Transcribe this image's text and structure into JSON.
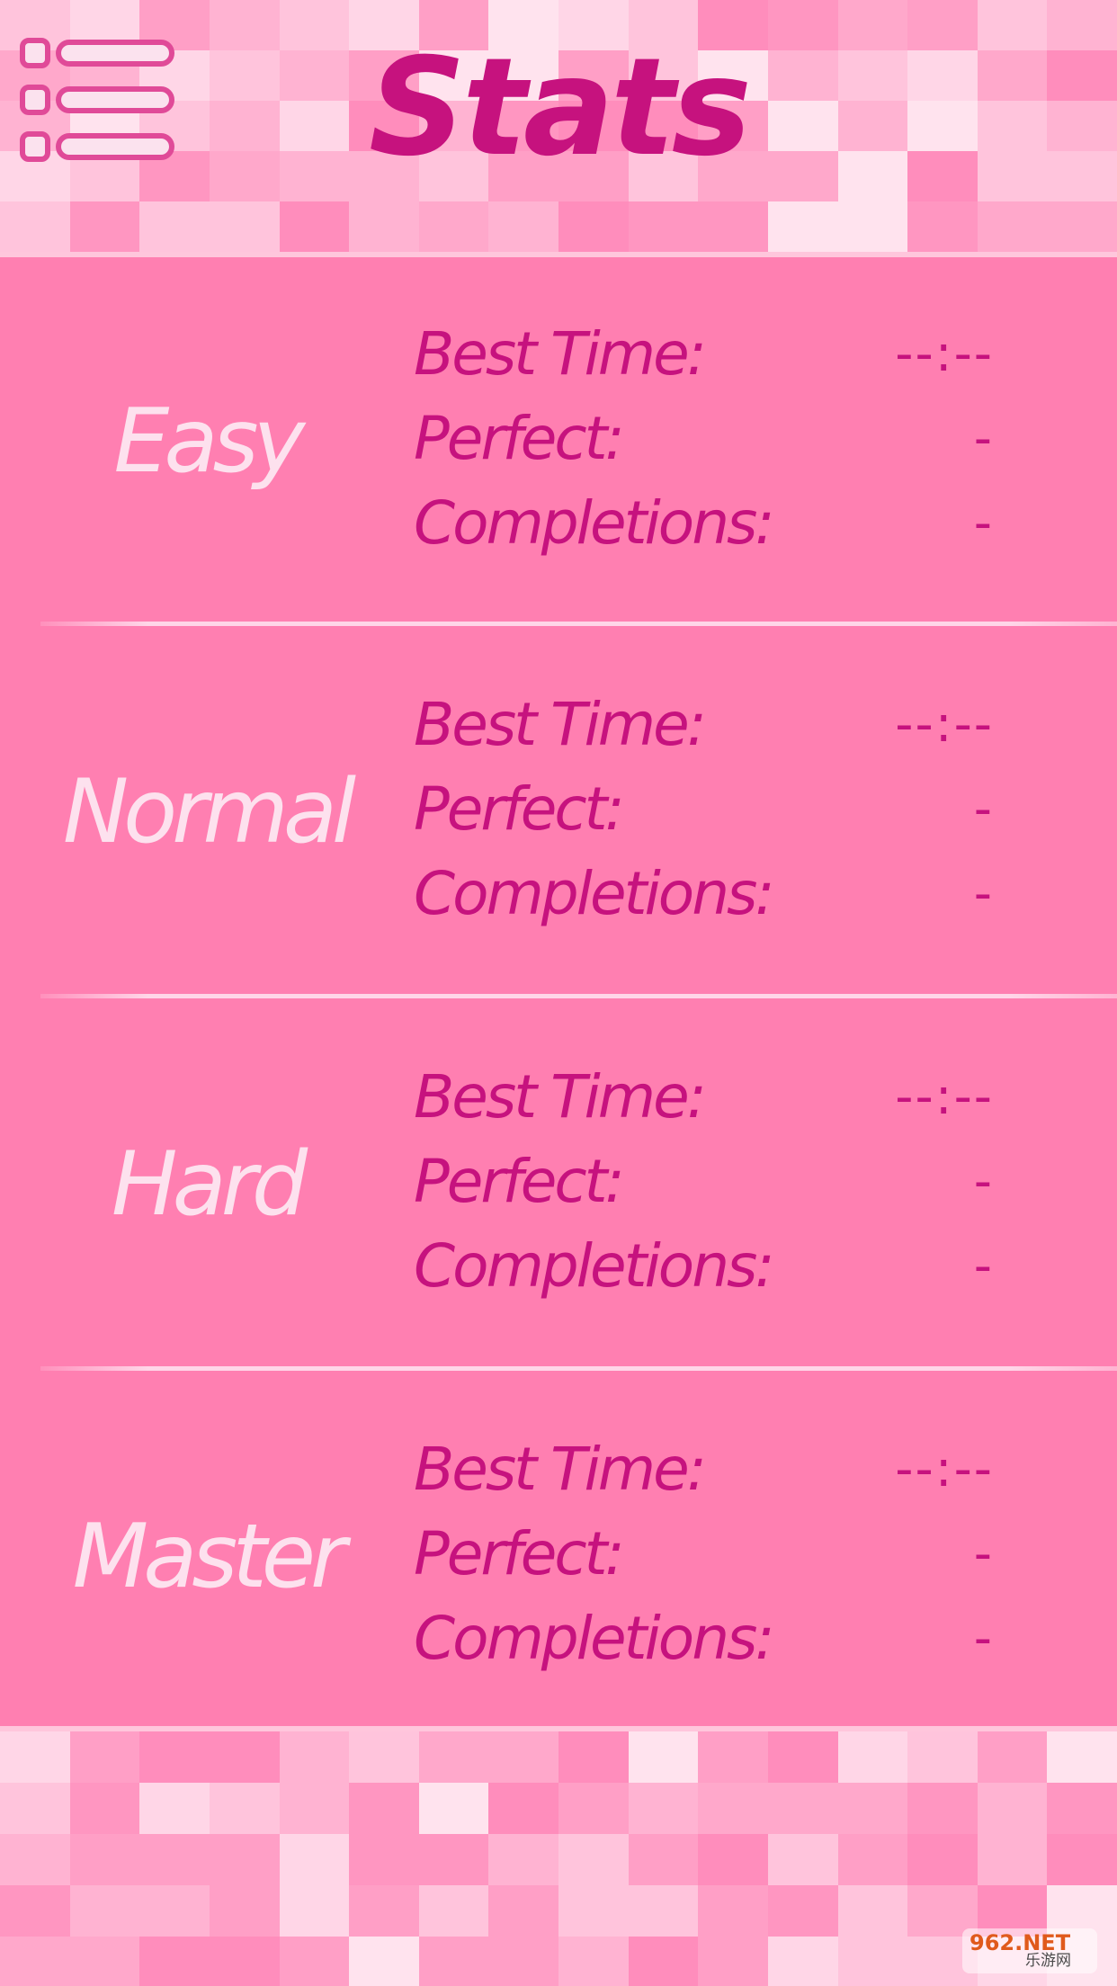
{
  "header": {
    "title": "Stats",
    "menu_icon": "menu-list-icon"
  },
  "sections": [
    {
      "difficulty": "Easy",
      "stats": [
        {
          "label": "Best Time:",
          "value": "--:--"
        },
        {
          "label": "Perfect:",
          "value": "-"
        },
        {
          "label": "Completions:",
          "value": "-"
        }
      ]
    },
    {
      "difficulty": "Normal",
      "stats": [
        {
          "label": "Best Time:",
          "value": "--:--"
        },
        {
          "label": "Perfect:",
          "value": "-"
        },
        {
          "label": "Completions:",
          "value": "-"
        }
      ]
    },
    {
      "difficulty": "Hard",
      "stats": [
        {
          "label": "Best Time:",
          "value": "--:--"
        },
        {
          "label": "Perfect:",
          "value": "-"
        },
        {
          "label": "Completions:",
          "value": "-"
        }
      ]
    },
    {
      "difficulty": "Master",
      "stats": [
        {
          "label": "Best Time:",
          "value": "--:--"
        },
        {
          "label": "Perfect:",
          "value": "-"
        },
        {
          "label": "Completions:",
          "value": "-"
        }
      ]
    }
  ],
  "watermark": {
    "top": "962.NET",
    "bottom": "乐游网"
  },
  "colors": {
    "title": "#c6127e",
    "stat_text": "#c6127e",
    "difficulty_text": "#fde1ee",
    "panel": "#ff7fb1",
    "menu_outline": "#e04a98"
  }
}
